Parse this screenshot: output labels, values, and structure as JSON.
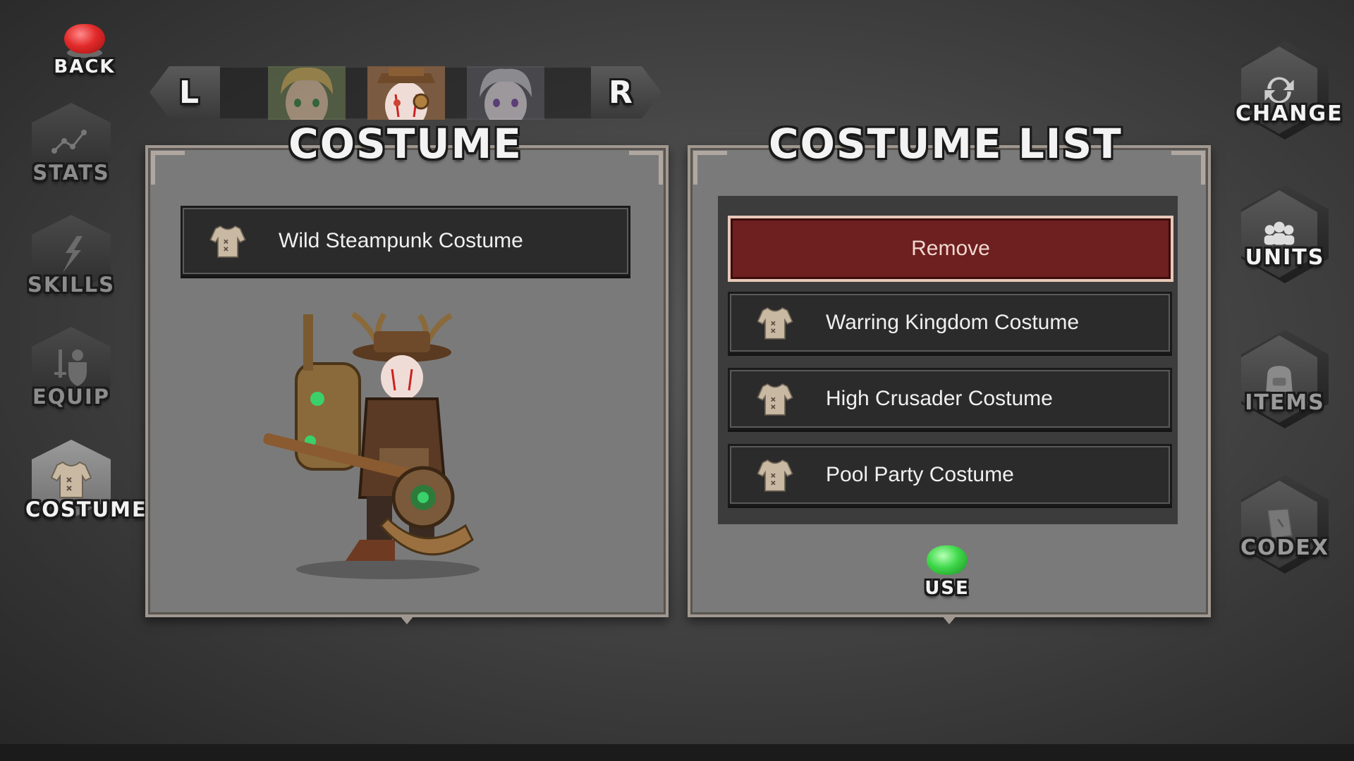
{
  "nav": {
    "back_label": "BACK",
    "left_menu": [
      {
        "label": "STATS",
        "icon": "stats-icon",
        "active": false
      },
      {
        "label": "SKILLS",
        "icon": "skills-icon",
        "active": false
      },
      {
        "label": "EQUIP",
        "icon": "equip-icon",
        "active": false
      },
      {
        "label": "COSTUME",
        "icon": "costume-icon",
        "active": true
      }
    ],
    "right_menu": [
      {
        "label": "CHANGE",
        "icon": "change-icon"
      },
      {
        "label": "UNITS",
        "icon": "units-icon"
      },
      {
        "label": "ITEMS",
        "icon": "items-icon"
      },
      {
        "label": "CODEX",
        "icon": "codex-icon"
      }
    ]
  },
  "selector": {
    "left_label": "L",
    "right_label": "R",
    "selected_index": 1
  },
  "costume_panel": {
    "title": "COSTUME",
    "equipped": "Wild Steampunk Costume"
  },
  "list_panel": {
    "title": "COSTUME LIST",
    "remove_label": "Remove",
    "items": [
      "Warring Kingdom Costume",
      "High Crusader Costume",
      "Pool Party Costume"
    ],
    "use_label": "USE"
  }
}
